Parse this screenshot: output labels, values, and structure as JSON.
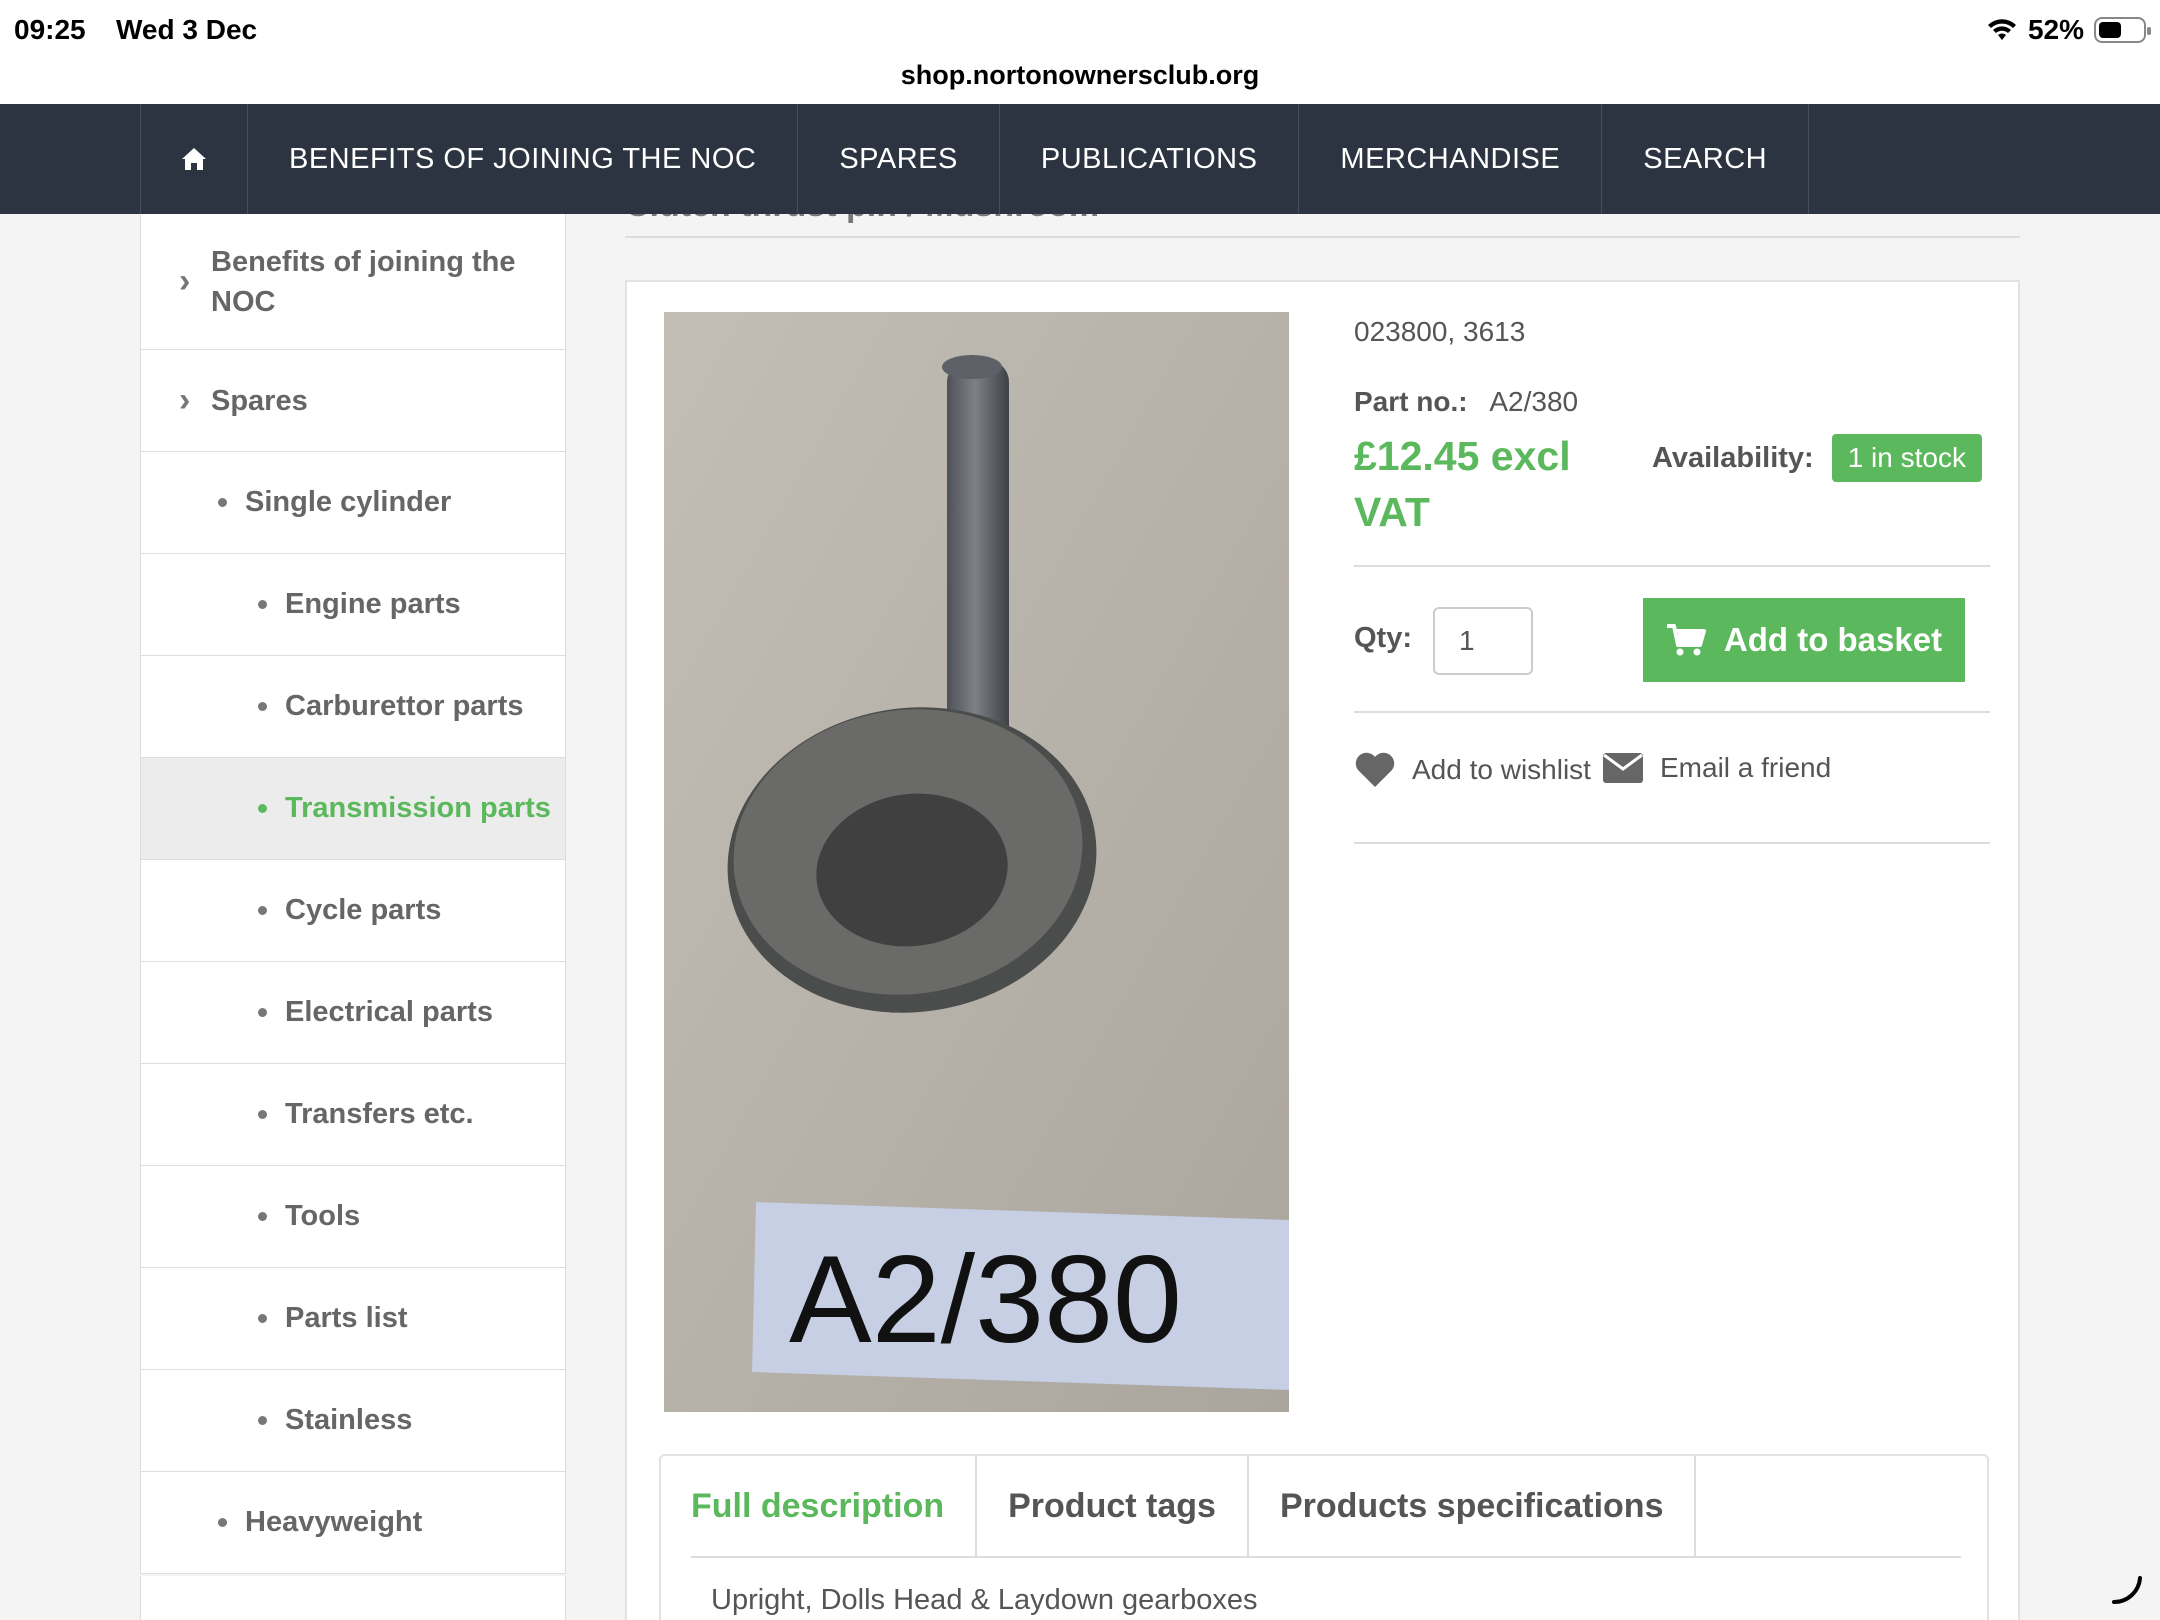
{
  "status_bar": {
    "time": "09:25",
    "date": "Wed 3 Dec",
    "url": "shop.nortonownersclub.org",
    "battery": "52%",
    "battery_level": 0.52
  },
  "topnav": {
    "items": [
      {
        "label": "BENEFITS OF JOINING THE NOC"
      },
      {
        "label": "SPARES"
      },
      {
        "label": "PUBLICATIONS"
      },
      {
        "label": "MERCHANDISE"
      },
      {
        "label": "SEARCH"
      }
    ]
  },
  "sidebar": {
    "items": [
      {
        "label": "Benefits of joining the NOC",
        "level": 0
      },
      {
        "label": "Spares",
        "level": 0
      },
      {
        "label": "Single cylinder",
        "level": 1
      },
      {
        "label": "Engine parts",
        "level": 2
      },
      {
        "label": "Carburettor parts",
        "level": 2
      },
      {
        "label": "Transmission parts",
        "level": 2,
        "active": true
      },
      {
        "label": "Cycle parts",
        "level": 2
      },
      {
        "label": "Electrical parts",
        "level": 2
      },
      {
        "label": "Transfers etc.",
        "level": 2
      },
      {
        "label": "Tools",
        "level": 2
      },
      {
        "label": "Parts list",
        "level": 2
      },
      {
        "label": "Stainless",
        "level": 2
      },
      {
        "label": "Heavyweight",
        "level": 1
      }
    ]
  },
  "product": {
    "title": "Clutch thrust pin / Mushroom",
    "codes": "023800, 3613",
    "part_no_label": "Part no.:",
    "part_no": "A2/380",
    "price": "£12.45 excl VAT",
    "availability_label": "Availability:",
    "availability": "1 in stock",
    "qty_label": "Qty:",
    "qty": "1",
    "basket_label": "Add to basket",
    "wishlist_label": "Add to wishlist",
    "email_label": "Email a friend",
    "image_label": "A2/380"
  },
  "tabs": [
    {
      "label": "Full description",
      "active": true
    },
    {
      "label": "Product tags"
    },
    {
      "label": "Products specifications"
    }
  ],
  "description": "Upright, Dolls Head & Laydown gearboxes",
  "colors": {
    "nav_bg": "#2b3440",
    "accent_green": "#5cb85c"
  }
}
